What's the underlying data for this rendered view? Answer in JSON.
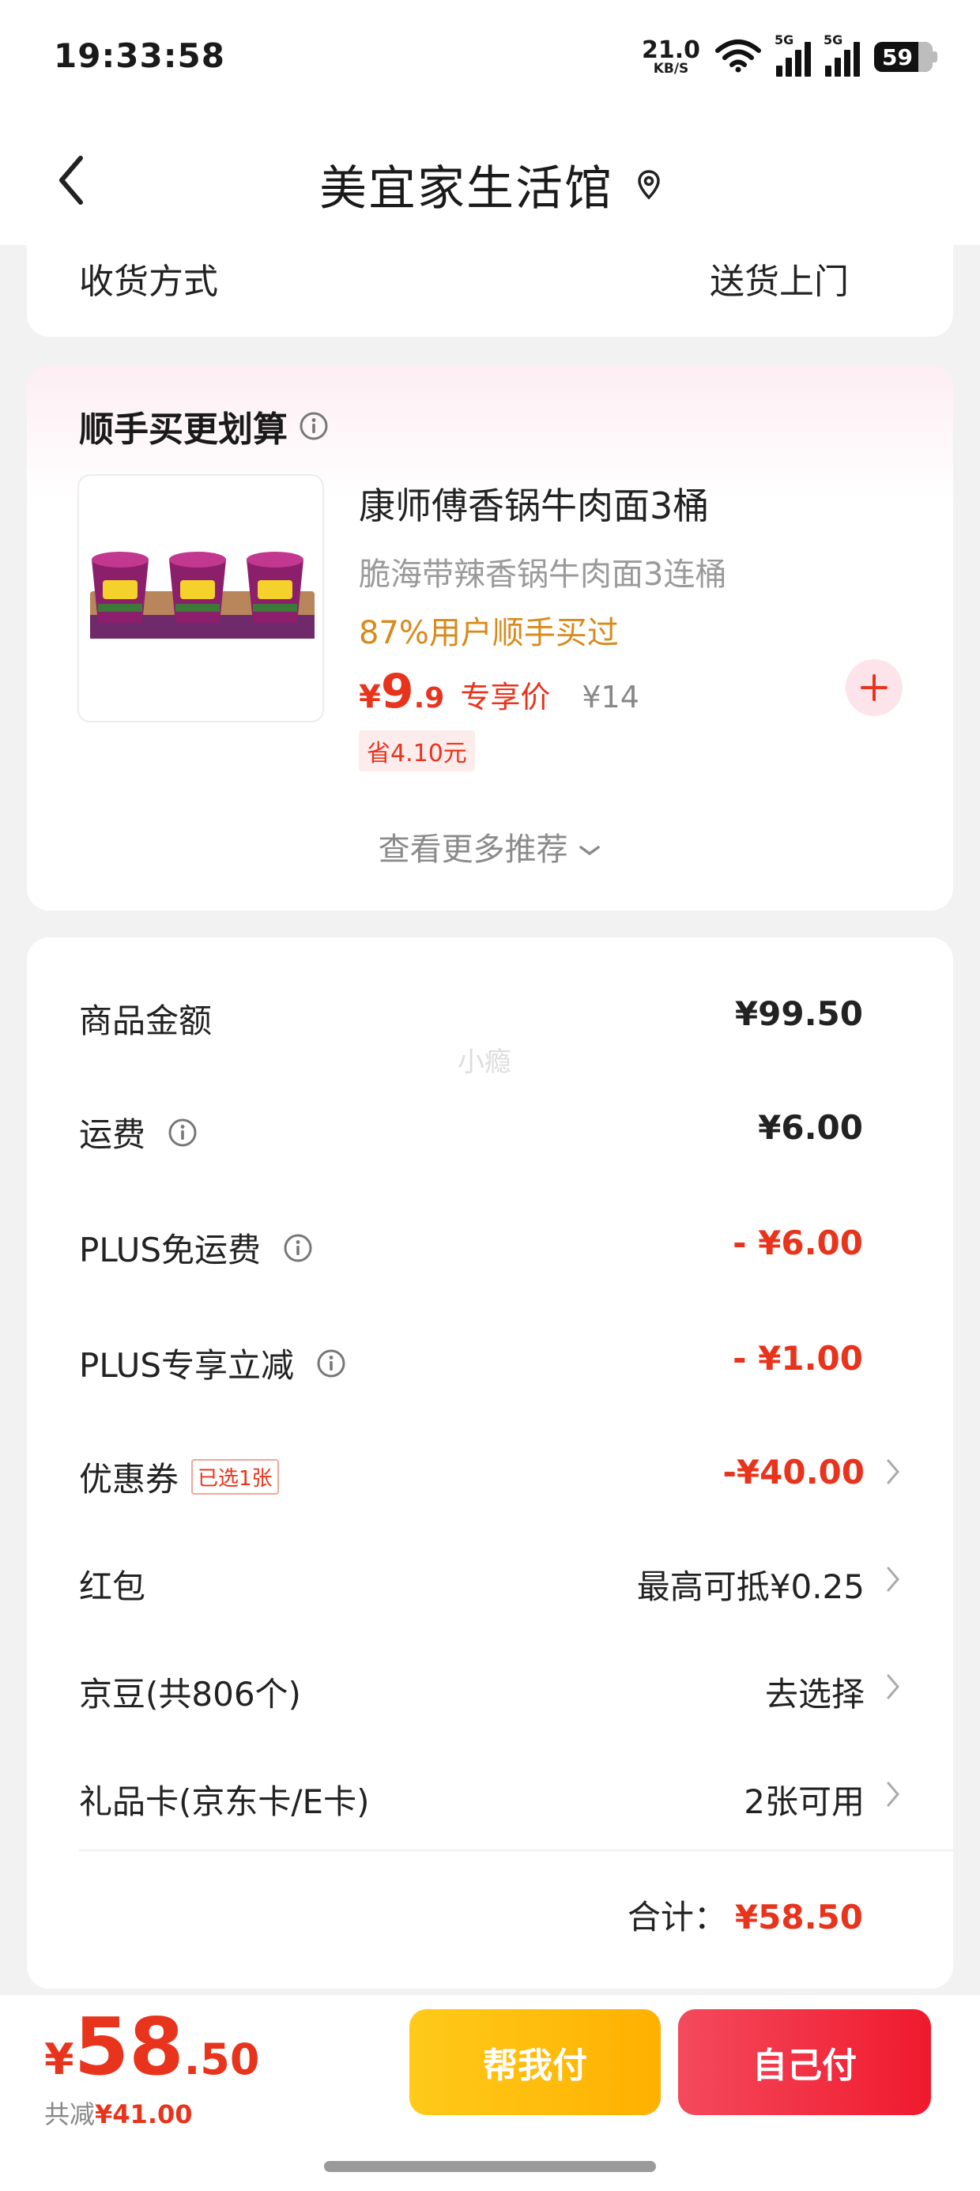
{
  "status_bar": {
    "time": "19:33:58",
    "net_speed_value": "21.0",
    "net_speed_unit": "KB/S",
    "signal1_label": "5G",
    "signal2_label": "5G",
    "battery": "59",
    "icons": [
      "wifi-icon",
      "signal-icon",
      "signal-icon",
      "battery-icon"
    ]
  },
  "nav": {
    "title": "美宜家生活馆",
    "icons": [
      "back-icon",
      "location-pin-icon"
    ]
  },
  "delivery": {
    "label": "收货方式",
    "value": "送货上门"
  },
  "recommend": {
    "title": "顺手买更划算",
    "product": {
      "name": "康师傅香锅牛肉面3桶",
      "subtitle": "脆海带辣香锅牛肉面3连桶",
      "bought": "87%用户顺手买过",
      "price_yen": "¥",
      "price_int": "9",
      "price_dec": ".9",
      "price_tag": "专享价",
      "old_price": "¥14",
      "save_badge": "省4.10元"
    },
    "more_link": "查看更多推荐"
  },
  "summary": {
    "watermark": "小瘾",
    "rows": [
      {
        "label": "商品金额",
        "value": "¥99.50"
      },
      {
        "label": "运费",
        "value": "¥6.00"
      },
      {
        "label": "PLUS免运费",
        "value": "- ¥6.00"
      },
      {
        "label": "PLUS专享立减",
        "value": "- ¥1.00"
      },
      {
        "label": "优惠券",
        "badge": "已选1张",
        "value": "-¥40.00"
      },
      {
        "label": "红包",
        "value": "最高可抵¥0.25"
      },
      {
        "label": "京豆(共806个)",
        "value": "去选择"
      },
      {
        "label": "礼品卡(京东卡/E卡)",
        "value": "2张可用"
      }
    ],
    "total_label": "合计：",
    "total_value": "¥58.50"
  },
  "bottom_bar": {
    "price_yen": "¥",
    "price_int": "58",
    "price_dec": ".50",
    "saved_label": "共减",
    "saved_value": "¥41.00",
    "help_pay": "帮我付",
    "self_pay": "自己付"
  },
  "colors": {
    "accent_red": "#e8341c",
    "bought_orange": "#d98a1c",
    "help_button": "#ffb000",
    "self_button": "#f0192d"
  }
}
